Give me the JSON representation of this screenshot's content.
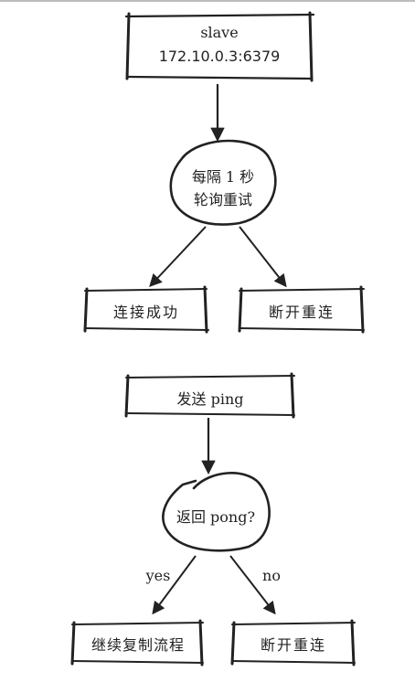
{
  "nodes": {
    "slave": {
      "title": "slave",
      "address": "172.10.0.3:6379"
    },
    "poll": {
      "line1": "每隔 1 秒",
      "line2": "轮询重试"
    },
    "connect_ok": {
      "label": "连接成功"
    },
    "disconnect_reconnect_1": {
      "label": "断开重连"
    },
    "send_ping": {
      "label": "发送 ping"
    },
    "pong_check": {
      "label": "返回 pong?"
    },
    "continue_replication": {
      "label": "继续复制流程"
    },
    "disconnect_reconnect_2": {
      "label": "断开重连"
    }
  },
  "edges": {
    "yes_label": "yes",
    "no_label": "no"
  },
  "colors": {
    "stroke": "#222222",
    "background": "#ffffff",
    "rule": "#bdbdbd"
  }
}
